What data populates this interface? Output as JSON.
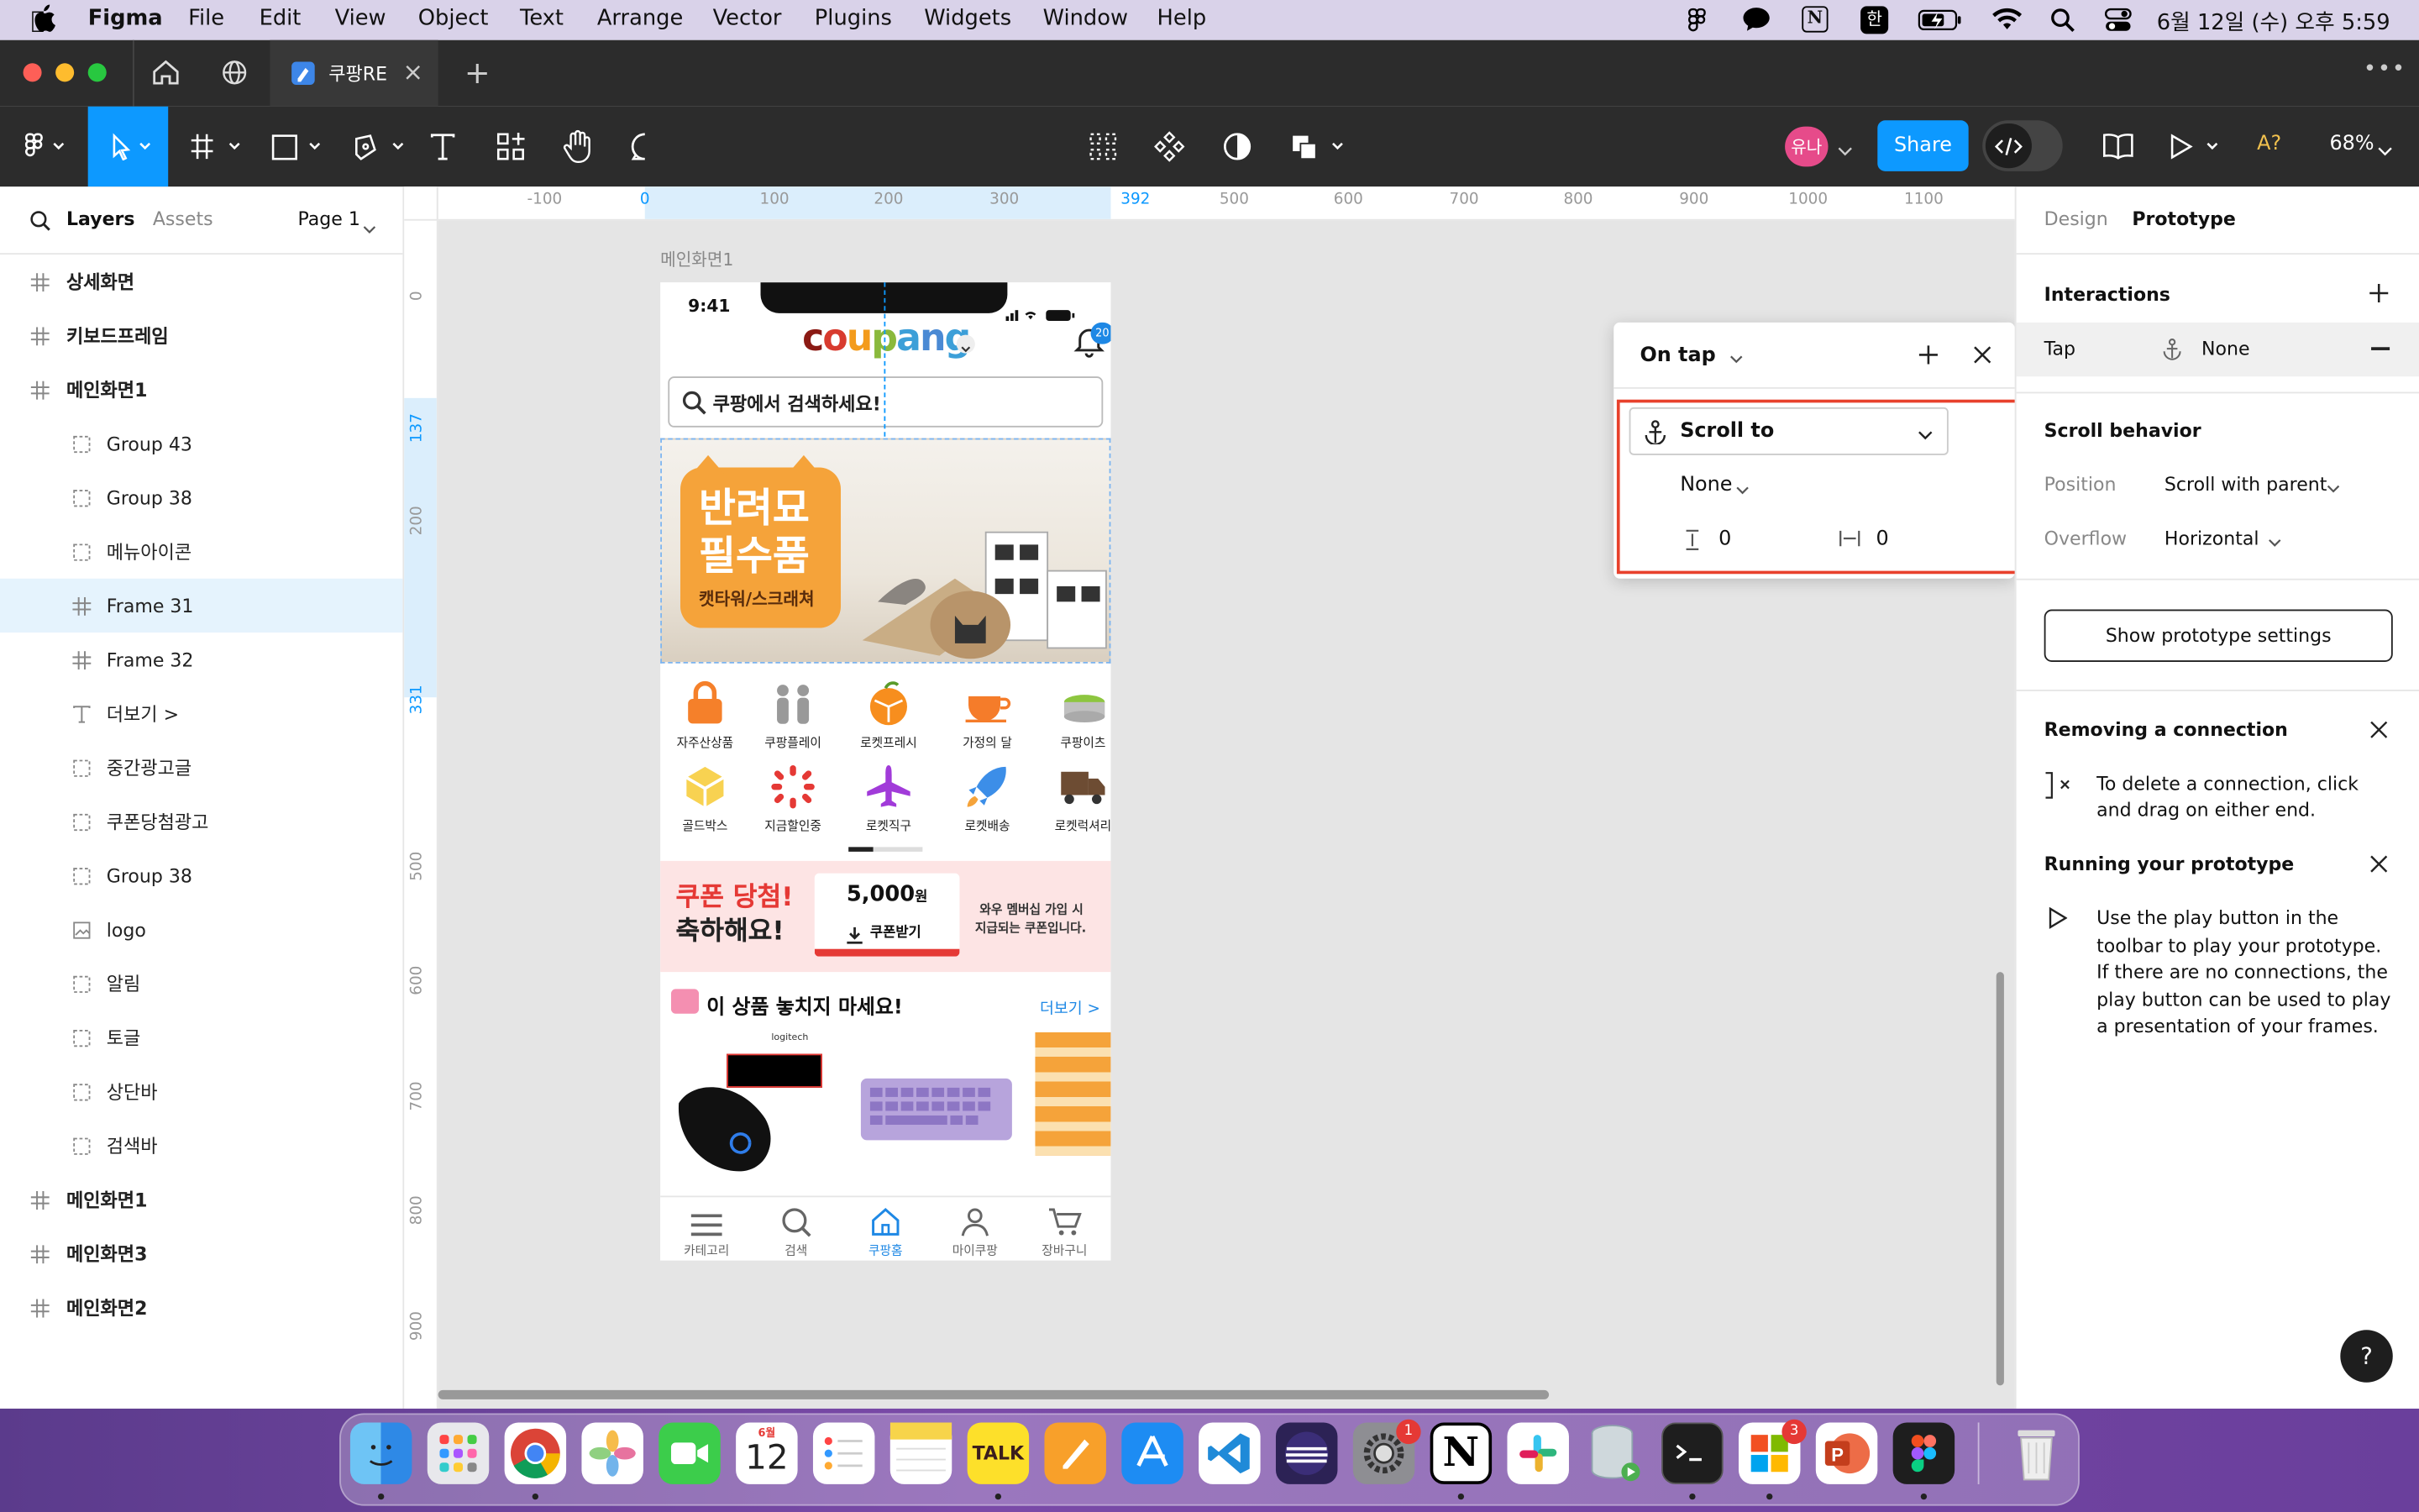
{
  "menubar": {
    "app": "Figma",
    "items": [
      "File",
      "Edit",
      "View",
      "Object",
      "Text",
      "Arrange",
      "Vector",
      "Plugins",
      "Widgets",
      "Window",
      "Help"
    ],
    "clock": "6월 12일 (수) 오후 5:59",
    "ime": "한"
  },
  "tab": {
    "title": "쿠팡RE"
  },
  "toolbar": {
    "share": "Share",
    "zoom": "68%",
    "avatar": "유나",
    "font_warning": "A?"
  },
  "left": {
    "tab_layers": "Layers",
    "tab_assets": "Assets",
    "page": "Page 1",
    "layers": [
      {
        "name": "상세화면",
        "type": "frame",
        "depth": 0
      },
      {
        "name": "키보드프레임",
        "type": "frame",
        "depth": 0
      },
      {
        "name": "메인화면1",
        "type": "frame",
        "depth": 0
      },
      {
        "name": "Group 43",
        "type": "group",
        "depth": 1
      },
      {
        "name": "Group 38",
        "type": "group",
        "depth": 1
      },
      {
        "name": "메뉴아이콘",
        "type": "group",
        "depth": 1
      },
      {
        "name": "Frame 31",
        "type": "frame",
        "depth": 1,
        "selected": true
      },
      {
        "name": "Frame 32",
        "type": "frame",
        "depth": 1
      },
      {
        "name": "더보기 >",
        "type": "text",
        "depth": 1
      },
      {
        "name": "중간광고글",
        "type": "group",
        "depth": 1
      },
      {
        "name": "쿠폰당첨광고",
        "type": "group",
        "depth": 1
      },
      {
        "name": "Group 38",
        "type": "group",
        "depth": 1
      },
      {
        "name": "logo",
        "type": "image",
        "depth": 1
      },
      {
        "name": "알림",
        "type": "group",
        "depth": 1
      },
      {
        "name": "토글",
        "type": "group",
        "depth": 1
      },
      {
        "name": "상단바",
        "type": "group",
        "depth": 1
      },
      {
        "name": "검색바",
        "type": "group",
        "depth": 1
      },
      {
        "name": "메인화면1",
        "type": "frame",
        "depth": 0
      },
      {
        "name": "메인화면3",
        "type": "frame",
        "depth": 0
      },
      {
        "name": "메인화면2",
        "type": "frame",
        "depth": 0
      }
    ]
  },
  "ruler": {
    "top": [
      "-100",
      "0",
      "100",
      "200",
      "300",
      "392",
      "500",
      "600",
      "700",
      "800",
      "900",
      "1000",
      "1100"
    ],
    "left": [
      "0",
      "137",
      "200",
      "331",
      "500",
      "600",
      "700",
      "800",
      "900"
    ]
  },
  "canvas": {
    "frame_label": "메인화면1"
  },
  "phone": {
    "time": "9:41",
    "logo": "coupang",
    "bell_count": "20",
    "search": "쿠팡에서 검색하세요!",
    "banner": {
      "line1": "반려묘",
      "line2": "필수품",
      "sub": "캣타워/스크래쳐"
    },
    "categories": [
      "자주산상품",
      "쿠팡플레이",
      "로켓프레시",
      "가정의 달",
      "쿠팡이츠",
      "골드박스",
      "지금할인중",
      "로켓직구",
      "로켓배송",
      "로켓럭셔리"
    ],
    "coupon": {
      "title1": "쿠폰 당첨!",
      "title2": "축하해요!",
      "amount": "5,000",
      "won": "원",
      "get": "쿠폰받기",
      "desc1": "와우 멤버십 가입 시",
      "desc2": "지급되는 쿠폰입니다."
    },
    "section": {
      "title": "이 상품 놓치지 마세요!",
      "more": "더보기 >",
      "brand": "logitech"
    },
    "nav": [
      "카테고리",
      "검색",
      "쿠팡홈",
      "마이쿠팡",
      "장바구니"
    ]
  },
  "popup": {
    "trigger": "On tap",
    "action": "Scroll to",
    "target": "None",
    "x": "0",
    "y": "0"
  },
  "right": {
    "tab_design": "Design",
    "tab_prototype": "Prototype",
    "interactions": "Interactions",
    "tap": "Tap",
    "tap_value": "None",
    "scroll_behavior": "Scroll behavior",
    "position_label": "Position",
    "position_value": "Scroll with parent",
    "overflow_label": "Overflow",
    "overflow_value": "Horizontal",
    "show_settings": "Show prototype settings",
    "tip1_title": "Removing a connection",
    "tip1_body": "To delete a connection, click and drag on either end.",
    "tip2_title": "Running your prototype",
    "tip2_body": "Use the play button in the toolbar to play your prototype. If there are no connections, the play button can be used to play a presentation of your frames.",
    "help": "?"
  },
  "dock": {
    "calendar_month": "6월",
    "calendar_day": "12",
    "talk": "TALK",
    "badge_settings": "1",
    "badge_office": "3"
  },
  "colors": {
    "accent": "#0d99ff",
    "share": "#0d99ff",
    "highlight": "#e8412c",
    "coupang_orange": "#f5a33a"
  }
}
